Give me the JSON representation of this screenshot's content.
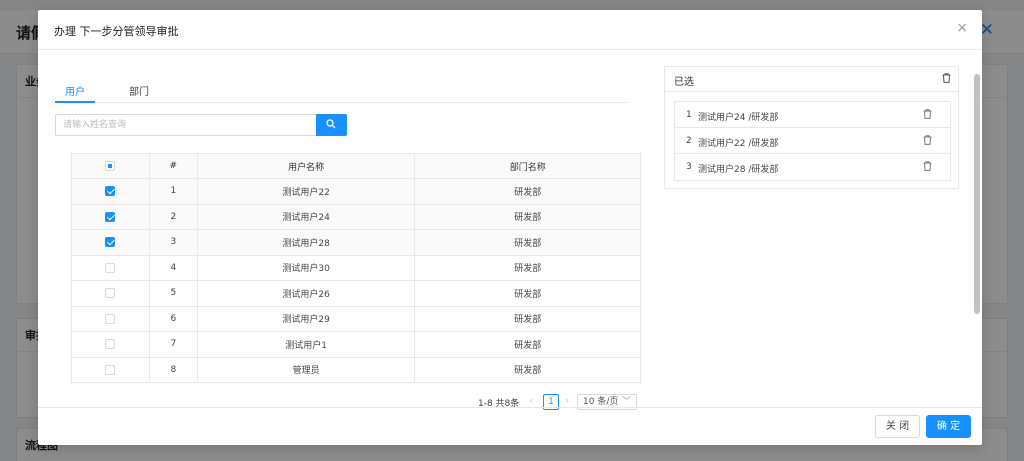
{
  "background": {
    "page_title": "请假",
    "card1_title": "业务",
    "card2_title": "审批",
    "card3_title": "流程图"
  },
  "modal": {
    "title": "办理 下一步分管领导审批",
    "close_glyph": "×"
  },
  "tabs": [
    {
      "label": "用户",
      "active": true
    },
    {
      "label": "部门",
      "active": false
    }
  ],
  "search": {
    "value": "",
    "placeholder": "请输入姓名查询"
  },
  "table": {
    "columns": [
      "#",
      "用户名称",
      "部门名称"
    ],
    "rows": [
      {
        "index": "1",
        "name": "测试用户22",
        "dept": "研发部",
        "checked": true
      },
      {
        "index": "2",
        "name": "测试用户24",
        "dept": "研发部",
        "checked": true
      },
      {
        "index": "3",
        "name": "测试用户28",
        "dept": "研发部",
        "checked": true
      },
      {
        "index": "4",
        "name": "测试用户30",
        "dept": "研发部",
        "checked": false
      },
      {
        "index": "5",
        "name": "测试用户26",
        "dept": "研发部",
        "checked": false
      },
      {
        "index": "6",
        "name": "测试用户29",
        "dept": "研发部",
        "checked": false
      },
      {
        "index": "7",
        "name": "测试用户1",
        "dept": "研发部",
        "checked": false
      },
      {
        "index": "8",
        "name": "管理员",
        "dept": "研发部",
        "checked": false
      }
    ]
  },
  "pagination": {
    "total_text": "1-8 共8条",
    "prev_glyph": "‹",
    "current_page": "1",
    "next_glyph": "›",
    "page_size": "10 条/页",
    "size_caret": "﹀"
  },
  "selected_panel": {
    "title": "已选",
    "items": [
      {
        "num": "1",
        "text": "测试用户24 /研发部"
      },
      {
        "num": "2",
        "text": "测试用户22 /研发部"
      },
      {
        "num": "3",
        "text": "测试用户28 /研发部"
      }
    ]
  },
  "footer": {
    "close_label": "关 闭",
    "ok_label": "确 定"
  },
  "colors": {
    "primary": "#1890ff",
    "border": "#e8e8e8"
  }
}
